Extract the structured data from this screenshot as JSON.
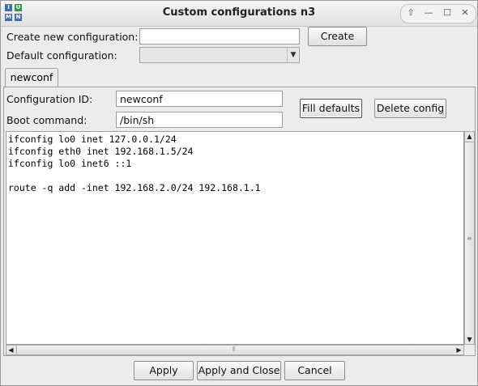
{
  "window": {
    "title": "Custom configurations n3",
    "app_icon": {
      "name": "imunes-app-icon",
      "letters": [
        "I",
        "M",
        "U",
        "N"
      ]
    },
    "controls": [
      {
        "name": "up-icon",
        "glyph": "⇧"
      },
      {
        "name": "minimize-icon",
        "glyph": "—"
      },
      {
        "name": "maximize-icon",
        "glyph": "☐"
      },
      {
        "name": "close-icon",
        "glyph": "✕"
      }
    ]
  },
  "create": {
    "label": "Create new configuration:",
    "input_value": "",
    "button_label": "Create"
  },
  "default_config": {
    "label": "Default configuration:",
    "selected_value": "",
    "arrow_icon": "chevron-down-icon"
  },
  "tabs": [
    {
      "label": "newconf"
    }
  ],
  "config": {
    "id_label": "Configuration ID:",
    "id_value": "newconf",
    "boot_label": "Boot command:",
    "boot_value": "/bin/sh",
    "fill_defaults_label": "Fill defaults",
    "delete_label": "Delete config"
  },
  "editor": {
    "lines": [
      "ifconfig lo0 inet 127.0.0.1/24",
      "ifconfig eth0 inet 192.168.1.5/24",
      "ifconfig lo0 inet6 ::1",
      "",
      "route -q add -inet 192.168.2.0/24 192.168.1.1"
    ]
  },
  "footer": {
    "apply_label": "Apply",
    "apply_close_label": "Apply and Close",
    "cancel_label": "Cancel"
  }
}
